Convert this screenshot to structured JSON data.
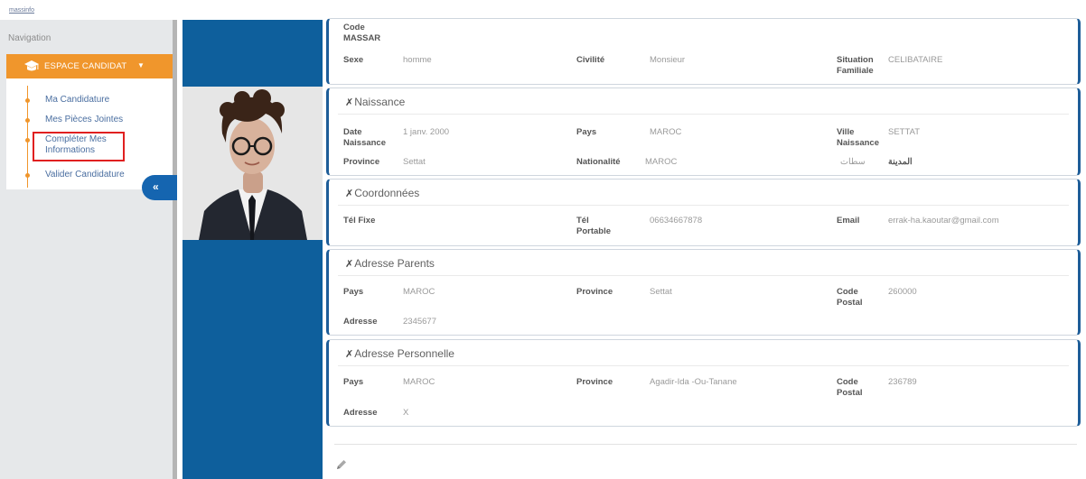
{
  "app": {
    "brand": "massinfo"
  },
  "sidebar": {
    "nav_title": "Navigation",
    "section_label": "ESPACE CANDIDAT",
    "items": [
      {
        "label": "Ma Candidature"
      },
      {
        "label": "Mes Pièces Jointes"
      },
      {
        "label": "Compléter Mes Informations"
      },
      {
        "label": "Valider Candidature"
      }
    ],
    "collapse_glyph": "«",
    "accent_color": "#f0962c",
    "highlight_color": "#e02020"
  },
  "identity": {
    "code_massar_label": "Code MASSAR",
    "sexe_label": "Sexe",
    "sexe_value": "homme",
    "civilite_label": "Civilité",
    "civilite_value": "Monsieur",
    "situation_label": "Situation Familiale",
    "situation_value": "CELIBATAIRE"
  },
  "naissance": {
    "title": "Naissance",
    "date_label": "Date Naissance",
    "date_value": "1 janv. 2000",
    "pays_label": "Pays",
    "pays_value": "MAROC",
    "ville_label": "Ville Naissance",
    "ville_value": "SETTAT",
    "province_label": "Province",
    "province_value": "Settat",
    "nationalite_label": "Nationalité",
    "nationalite_value": "MAROC",
    "ville_ar_value": "سطات",
    "ville_ar_label": "المدينة"
  },
  "coordonnees": {
    "title": "Coordonnées",
    "tel_fixe_label": "Tél Fixe",
    "tel_fixe_value": "",
    "tel_portable_label": "Tél Portable",
    "tel_portable_value": "06634667878",
    "email_label": "Email",
    "email_value": "errak-ha.kaoutar@gmail.com"
  },
  "adresse_parents": {
    "title": "Adresse Parents",
    "pays_label": "Pays",
    "pays_value": "MAROC",
    "province_label": "Province",
    "province_value": "Settat",
    "code_postal_label": "Code Postal",
    "code_postal_value": "260000",
    "adresse_label": "Adresse",
    "adresse_value": "2345677"
  },
  "adresse_personnelle": {
    "title": "Adresse Personnelle",
    "pays_label": "Pays",
    "pays_value": "MAROC",
    "province_label": "Province",
    "province_value": "Agadir-Ida -Ou-Tanane",
    "code_postal_label": "Code Postal",
    "code_postal_value": "236789",
    "adresse_label": "Adresse",
    "adresse_value": "X"
  },
  "colors": {
    "primary_blue": "#0e5f9c",
    "card_border": "#1e5d98"
  },
  "icons": {
    "section_icon": "pin-icon",
    "edit_icon": "pencil-icon",
    "espace_icon": "graduation-cap-icon"
  }
}
